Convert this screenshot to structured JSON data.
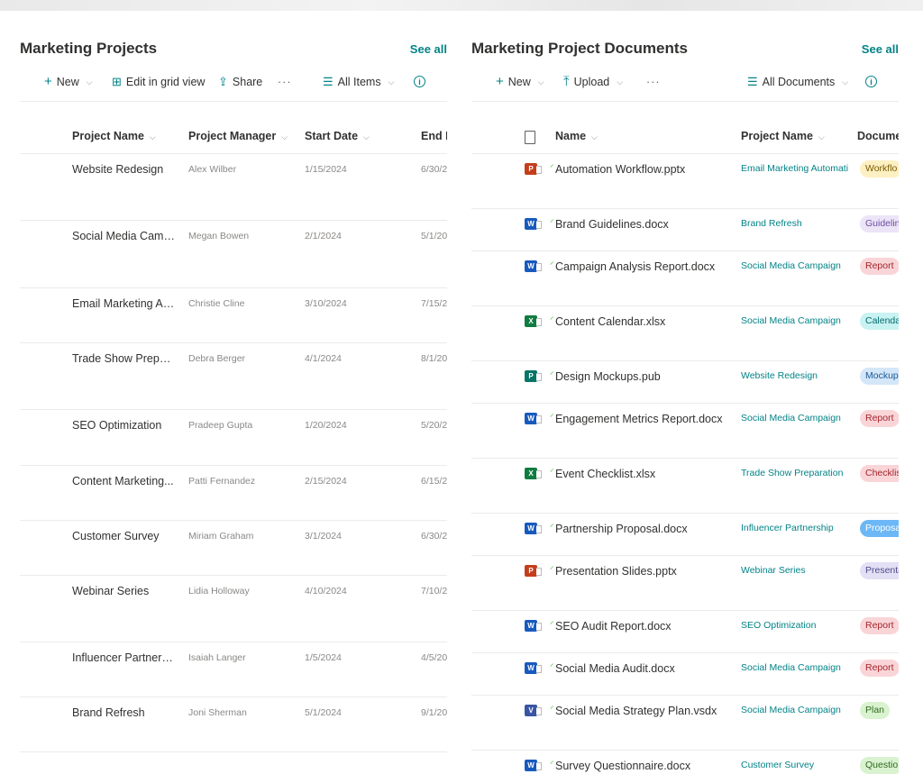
{
  "left": {
    "title": "Marketing Projects",
    "see_all": "See all",
    "cmd": {
      "new": "New",
      "edit_grid": "Edit in grid view",
      "share": "Share",
      "more": "···",
      "view": "All Items"
    },
    "headers": {
      "name": "Project Name",
      "manager": "Project Manager",
      "start": "Start Date",
      "end": "End D"
    },
    "rows": [
      {
        "name": "Website Redesign",
        "manager": "Alex Wilber",
        "start": "1/15/2024",
        "end": "6/30/2"
      },
      {
        "name": "Social Media Camp...",
        "manager": "Megan Bowen",
        "start": "2/1/2024",
        "end": "5/1/20"
      },
      {
        "name": "Email Marketing Au...",
        "manager": "Christie Cline",
        "start": "3/10/2024",
        "end": "7/15/2"
      },
      {
        "name": "Trade Show Prepar...",
        "manager": "Debra Berger",
        "start": "4/1/2024",
        "end": "8/1/20"
      },
      {
        "name": "SEO Optimization",
        "manager": "Pradeep Gupta",
        "start": "1/20/2024",
        "end": "5/20/2"
      },
      {
        "name": "Content Marketing...",
        "manager": "Patti Fernandez",
        "start": "2/15/2024",
        "end": "6/15/2"
      },
      {
        "name": "Customer Survey",
        "manager": "Miriam Graham",
        "start": "3/1/2024",
        "end": "6/30/2"
      },
      {
        "name": "Webinar Series",
        "manager": "Lidia Holloway",
        "start": "4/10/2024",
        "end": "7/10/2"
      },
      {
        "name": "Influencer Partners...",
        "manager": "Isaiah Langer",
        "start": "1/5/2024",
        "end": "4/5/20"
      },
      {
        "name": "Brand Refresh",
        "manager": "Joni Sherman",
        "start": "5/1/2024",
        "end": "9/1/20"
      }
    ]
  },
  "right": {
    "title": "Marketing Project Documents",
    "see_all": "See all",
    "cmd": {
      "new": "New",
      "upload": "Upload",
      "more": "···",
      "view": "All Documents"
    },
    "headers": {
      "name": "Name",
      "project": "Project Name",
      "doc": "Docume"
    },
    "rows": [
      {
        "icon": "powerpoint-icon",
        "name": "Automation Workflow.pptx",
        "project": "Email Marketing Automati",
        "tag": "Workflo",
        "tag_bg": "#fdf0c2",
        "tag_fg": "#7a5a00"
      },
      {
        "icon": "word-icon",
        "name": "Brand Guidelines.docx",
        "project": "Brand Refresh",
        "tag": "Guidelin",
        "tag_bg": "#ece4f7",
        "tag_fg": "#6b4ea0"
      },
      {
        "icon": "word-icon",
        "name": "Campaign Analysis Report.docx",
        "project": "Social Media Campaign",
        "tag": "Report",
        "tag_bg": "#f9d5d8",
        "tag_fg": "#a4262c"
      },
      {
        "icon": "excel-icon",
        "name": "Content Calendar.xlsx",
        "project": "Social Media Campaign",
        "tag": "Calenda",
        "tag_bg": "#c9f2f2",
        "tag_fg": "#006b6b"
      },
      {
        "icon": "publisher-icon",
        "name": "Design Mockups.pub",
        "project": "Website Redesign",
        "tag": "Mockup",
        "tag_bg": "#d4e7f8",
        "tag_fg": "#1a5a96"
      },
      {
        "icon": "word-icon",
        "name": "Engagement Metrics Report.docx",
        "project": "Social Media Campaign",
        "tag": "Report",
        "tag_bg": "#f9d5d8",
        "tag_fg": "#a4262c"
      },
      {
        "icon": "excel-icon",
        "name": "Event Checklist.xlsx",
        "project": "Trade Show Preparation",
        "tag": "Checklis",
        "tag_bg": "#f9d5d8",
        "tag_fg": "#a4262c"
      },
      {
        "icon": "word-icon",
        "name": "Partnership Proposal.docx",
        "project": "Influencer Partnership",
        "tag": "Proposa",
        "tag_bg": "#6cb8f6",
        "tag_fg": "#ffffff"
      },
      {
        "icon": "powerpoint-icon",
        "name": "Presentation Slides.pptx",
        "project": "Webinar Series",
        "tag": "Presenta",
        "tag_bg": "#e3e0f5",
        "tag_fg": "#4f4a8c"
      },
      {
        "icon": "word-icon",
        "name": "SEO Audit Report.docx",
        "project": "SEO Optimization",
        "tag": "Report",
        "tag_bg": "#f9d5d8",
        "tag_fg": "#a4262c"
      },
      {
        "icon": "word-icon",
        "name": "Social Media Audit.docx",
        "project": "Social Media Campaign",
        "tag": "Report",
        "tag_bg": "#f9d5d8",
        "tag_fg": "#a4262c"
      },
      {
        "icon": "visio-icon",
        "name": "Social Media Strategy Plan.vsdx",
        "project": "Social Media Campaign",
        "tag": "Plan",
        "tag_bg": "#d9f2d0",
        "tag_fg": "#2f6b1f"
      },
      {
        "icon": "word-icon",
        "name": "Survey Questionnaire.docx",
        "project": "Customer Survey",
        "tag": "Questio",
        "tag_bg": "#d9f2d0",
        "tag_fg": "#2f6b1f"
      }
    ]
  },
  "colors": {
    "accent": "#038387",
    "text": "#323130",
    "muted": "#8a8886",
    "divider": "#edebe9"
  }
}
